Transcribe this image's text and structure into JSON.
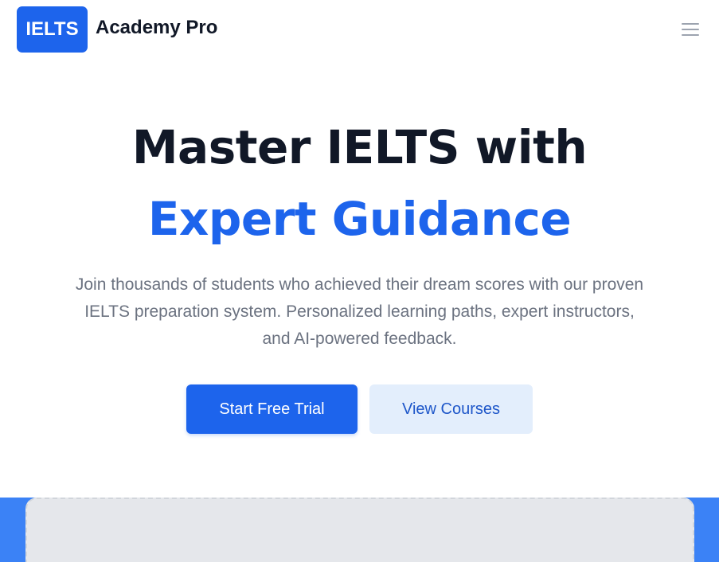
{
  "header": {
    "logo_text": "IELTS",
    "brand_name": "Academy Pro",
    "menu_icon": "hamburger-menu-icon"
  },
  "hero": {
    "title_line1": "Master IELTS with",
    "title_line2": "Expert Guidance",
    "subtitle": "Join thousands of students who achieved their dream scores with our proven IELTS preparation system. Personalized learning paths, expert instructors, and AI-powered feedback.",
    "primary_button": "Start Free Trial",
    "secondary_button": "View Courses"
  },
  "colors": {
    "brand_blue": "#1d64ec",
    "heading_dark": "#111827",
    "body_gray": "#6b7280",
    "secondary_button_bg": "#e3eefc",
    "band_blue": "#3b82f6",
    "placeholder_gray": "#e5e7eb"
  }
}
